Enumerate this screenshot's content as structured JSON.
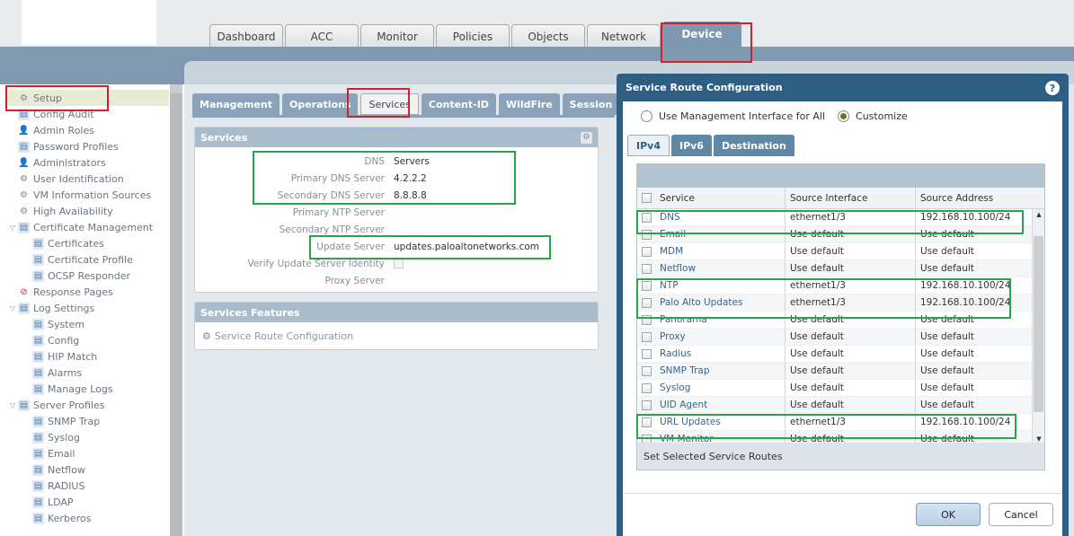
{
  "top_tabs": [
    "Dashboard",
    "ACC",
    "Monitor",
    "Policies",
    "Objects",
    "Network",
    "Device"
  ],
  "sidebar": {
    "items": [
      {
        "label": "Setup",
        "indent": 0,
        "icon": "setup-gear-icon",
        "selected": true
      },
      {
        "label": "Config Audit",
        "indent": 0,
        "icon": "config-audit-icon"
      },
      {
        "label": "Admin Roles",
        "indent": 0,
        "icon": "admin-roles-icon"
      },
      {
        "label": "Password Profiles",
        "indent": 0,
        "icon": "password-profiles-icon"
      },
      {
        "label": "Administrators",
        "indent": 0,
        "icon": "administrators-icon"
      },
      {
        "label": "User Identification",
        "indent": 0,
        "icon": "user-identification-icon"
      },
      {
        "label": "VM Information Sources",
        "indent": 0,
        "icon": "vm-sources-icon"
      },
      {
        "label": "High Availability",
        "indent": 0,
        "icon": "high-availability-icon"
      },
      {
        "label": "Certificate Management",
        "indent": 0,
        "icon": "certificate-management-icon",
        "expanded": true
      },
      {
        "label": "Certificates",
        "indent": 1,
        "icon": "certificates-icon"
      },
      {
        "label": "Certificate Profile",
        "indent": 1,
        "icon": "certificate-profile-icon"
      },
      {
        "label": "OCSP Responder",
        "indent": 1,
        "icon": "ocsp-responder-icon"
      },
      {
        "label": "Response Pages",
        "indent": 0,
        "icon": "response-pages-icon"
      },
      {
        "label": "Log Settings",
        "indent": 0,
        "icon": "log-settings-icon",
        "expanded": true
      },
      {
        "label": "System",
        "indent": 1,
        "icon": "system-log-icon"
      },
      {
        "label": "Config",
        "indent": 1,
        "icon": "config-log-icon"
      },
      {
        "label": "HIP Match",
        "indent": 1,
        "icon": "hip-match-icon"
      },
      {
        "label": "Alarms",
        "indent": 1,
        "icon": "alarms-icon"
      },
      {
        "label": "Manage Logs",
        "indent": 1,
        "icon": "manage-logs-icon"
      },
      {
        "label": "Server Profiles",
        "indent": 0,
        "icon": "server-profiles-icon",
        "expanded": true
      },
      {
        "label": "SNMP Trap",
        "indent": 1,
        "icon": "snmp-trap-icon"
      },
      {
        "label": "Syslog",
        "indent": 1,
        "icon": "syslog-icon"
      },
      {
        "label": "Email",
        "indent": 1,
        "icon": "email-icon"
      },
      {
        "label": "Netflow",
        "indent": 1,
        "icon": "netflow-icon"
      },
      {
        "label": "RADIUS",
        "indent": 1,
        "icon": "radius-icon"
      },
      {
        "label": "LDAP",
        "indent": 1,
        "icon": "ldap-icon"
      },
      {
        "label": "Kerberos",
        "indent": 1,
        "icon": "kerberos-icon"
      }
    ]
  },
  "sub_tabs": [
    "Management",
    "Operations",
    "Services",
    "Content-ID",
    "WildFire",
    "Session"
  ],
  "services_panel": {
    "title": "Services",
    "rows": [
      {
        "label": "DNS",
        "value": "Servers"
      },
      {
        "label": "Primary DNS Server",
        "value": "4.2.2.2"
      },
      {
        "label": "Secondary DNS Server",
        "value": "8.8.8.8"
      },
      {
        "label": "Primary NTP Server",
        "value": ""
      },
      {
        "label": "Secondary NTP Server",
        "value": ""
      },
      {
        "label": "Update Server",
        "value": "updates.paloaltonetworks.com"
      },
      {
        "label": "Verify Update Server Identity",
        "value": ""
      },
      {
        "label": "Proxy Server",
        "value": ""
      }
    ]
  },
  "features_panel": {
    "title": "Services Features",
    "link": "Service Route Configuration"
  },
  "modal": {
    "title": "Service Route Configuration",
    "radio_mgmt": "Use Management Interface for All",
    "radio_custom": "Customize",
    "tabs": [
      "IPv4",
      "IPv6",
      "Destination"
    ],
    "columns": {
      "service": "Service",
      "interface": "Source Interface",
      "address": "Source Address"
    },
    "rows": [
      {
        "service": "DNS",
        "interface": "ethernet1/3",
        "address": "192.168.10.100/24"
      },
      {
        "service": "Email",
        "interface": "Use default",
        "address": "Use default"
      },
      {
        "service": "MDM",
        "interface": "Use default",
        "address": "Use default"
      },
      {
        "service": "Netflow",
        "interface": "Use default",
        "address": "Use default"
      },
      {
        "service": "NTP",
        "interface": "ethernet1/3",
        "address": "192.168.10.100/24"
      },
      {
        "service": "Palo Alto Updates",
        "interface": "ethernet1/3",
        "address": "192.168.10.100/24"
      },
      {
        "service": "Panorama",
        "interface": "Use default",
        "address": "Use default"
      },
      {
        "service": "Proxy",
        "interface": "Use default",
        "address": "Use default"
      },
      {
        "service": "Radius",
        "interface": "Use default",
        "address": "Use default"
      },
      {
        "service": "SNMP Trap",
        "interface": "Use default",
        "address": "Use default"
      },
      {
        "service": "Syslog",
        "interface": "Use default",
        "address": "Use default"
      },
      {
        "service": "UID Agent",
        "interface": "Use default",
        "address": "Use default"
      },
      {
        "service": "URL Updates",
        "interface": "ethernet1/3",
        "address": "192.168.10.100/24"
      },
      {
        "service": "VM Monitor",
        "interface": "Use default",
        "address": "Use default"
      }
    ],
    "footer_link": "Set Selected Service Routes",
    "ok": "OK",
    "cancel": "Cancel"
  }
}
